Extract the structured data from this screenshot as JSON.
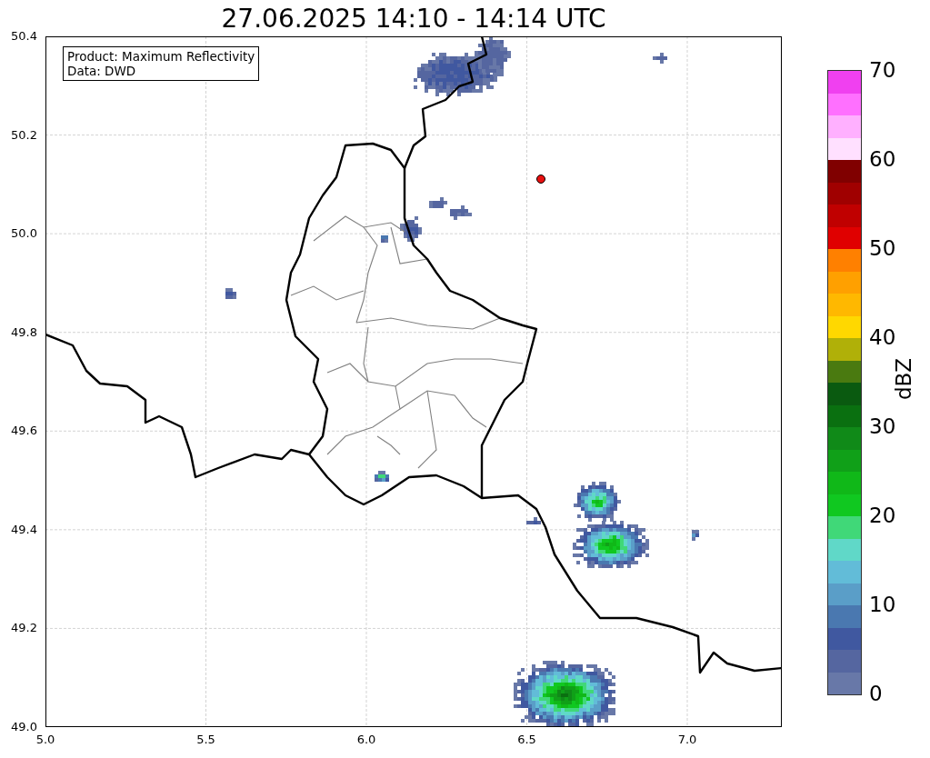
{
  "title": "27.06.2025 14:10 - 14:14 UTC",
  "legend": {
    "lines": [
      "Product: Maximum Reflectivity",
      "Data: DWD"
    ]
  },
  "x_ticks": [
    "5.0",
    "5.5",
    "6.0",
    "6.5",
    "7.0"
  ],
  "y_ticks": [
    "50.4",
    "50.2",
    "50.0",
    "49.8",
    "49.6",
    "49.4",
    "49.2",
    "49.0"
  ],
  "colorbar": {
    "label": "dBZ",
    "ticks": [
      "70",
      "60",
      "50",
      "40",
      "30",
      "20",
      "10",
      "0"
    ],
    "segments": [
      {
        "color": "#6878a8"
      },
      {
        "color": "#5566a0"
      },
      {
        "color": "#4058a0"
      },
      {
        "color": "#4a78b0"
      },
      {
        "color": "#5a9ec8"
      },
      {
        "color": "#62bcd8"
      },
      {
        "color": "#60d8c8"
      },
      {
        "color": "#40d878"
      },
      {
        "color": "#10c820"
      },
      {
        "color": "#10b818"
      },
      {
        "color": "#10a018"
      },
      {
        "color": "#108a18"
      },
      {
        "color": "#0a7010"
      },
      {
        "color": "#0a5a10"
      },
      {
        "color": "#4a7a10"
      },
      {
        "color": "#b0b008"
      },
      {
        "color": "#ffd800"
      },
      {
        "color": "#ffb800"
      },
      {
        "color": "#ffa000"
      },
      {
        "color": "#ff8000"
      },
      {
        "color": "#e00000"
      },
      {
        "color": "#c00000"
      },
      {
        "color": "#a00000"
      },
      {
        "color": "#800000"
      },
      {
        "color": "#ffe0ff"
      },
      {
        "color": "#ffb0ff"
      },
      {
        "color": "#ff70ff"
      },
      {
        "color": "#f040f0"
      }
    ]
  }
}
